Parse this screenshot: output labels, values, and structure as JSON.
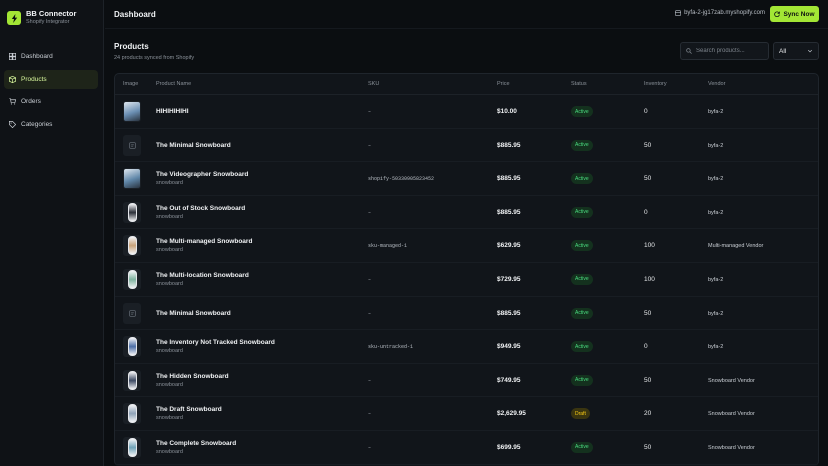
{
  "app": {
    "name": "BB Connector",
    "subtitle": "Shopify Integrator",
    "accent": "#a3e635"
  },
  "nav": [
    {
      "label": "Dashboard",
      "icon": "dashboard-icon",
      "active": false
    },
    {
      "label": "Products",
      "icon": "package-icon",
      "active": true
    },
    {
      "label": "Orders",
      "icon": "cart-icon",
      "active": false
    },
    {
      "label": "Categories",
      "icon": "tag-icon",
      "active": false
    }
  ],
  "header": {
    "title": "Dashboard",
    "store": "byfa-2-jg17zab.myshopify.com",
    "sync_label": "Sync Now"
  },
  "products": {
    "title": "Products",
    "subtitle": "24 products synced from Shopify",
    "search_placeholder": "Search products...",
    "filter_value": "All",
    "columns": [
      "Image",
      "Product Name",
      "SKU",
      "Price",
      "Status",
      "Inventory",
      "Vendor"
    ],
    "rows": [
      {
        "name": "HIHIHIHIHI",
        "type": "",
        "sku": "–",
        "price": "$10.00",
        "status": "Active",
        "inventory": "0",
        "vendor": "byfa-2",
        "thumb": "photo",
        "color": "#6b8fb3"
      },
      {
        "name": "The Minimal Snowboard",
        "type": "",
        "sku": "–",
        "price": "$885.95",
        "status": "Active",
        "inventory": "50",
        "vendor": "byfa-2",
        "thumb": "placeholder",
        "color": "#3a4149"
      },
      {
        "name": "The Videographer Snowboard",
        "type": "snowboard",
        "sku": "shopify-50330905823452",
        "price": "$885.95",
        "status": "Active",
        "inventory": "50",
        "vendor": "byfa-2",
        "thumb": "photo",
        "color": "#5f86a8"
      },
      {
        "name": "The Out of Stock Snowboard",
        "type": "snowboard",
        "sku": "–",
        "price": "$885.95",
        "status": "Active",
        "inventory": "0",
        "vendor": "byfa-2",
        "thumb": "board",
        "color": "#2b2f38"
      },
      {
        "name": "The Multi-managed Snowboard",
        "type": "snowboard",
        "sku": "sku-managed-1",
        "price": "$629.95",
        "status": "Active",
        "inventory": "100",
        "vendor": "Multi-managed Vendor",
        "thumb": "board",
        "color": "#c9a37a"
      },
      {
        "name": "The Multi-location Snowboard",
        "type": "snowboard",
        "sku": "–",
        "price": "$729.95",
        "status": "Active",
        "inventory": "100",
        "vendor": "byfa-2",
        "thumb": "board",
        "color": "#7fb3a0"
      },
      {
        "name": "The Minimal Snowboard",
        "type": "",
        "sku": "–",
        "price": "$885.95",
        "status": "Active",
        "inventory": "50",
        "vendor": "byfa-2",
        "thumb": "placeholder",
        "color": "#3a4149"
      },
      {
        "name": "The Inventory Not Tracked Snowboard",
        "type": "snowboard",
        "sku": "sku-untracked-1",
        "price": "$949.95",
        "status": "Active",
        "inventory": "0",
        "vendor": "byfa-2",
        "thumb": "board",
        "color": "#4d6fa8"
      },
      {
        "name": "The Hidden Snowboard",
        "type": "snowboard",
        "sku": "–",
        "price": "$749.95",
        "status": "Active",
        "inventory": "50",
        "vendor": "Snowboard Vendor",
        "thumb": "board",
        "color": "#3d4a63"
      },
      {
        "name": "The Draft Snowboard",
        "type": "snowboard",
        "sku": "–",
        "price": "$2,629.95",
        "status": "Draft",
        "inventory": "20",
        "vendor": "Snowboard Vendor",
        "thumb": "board",
        "color": "#8fa3b8"
      },
      {
        "name": "The Complete Snowboard",
        "type": "snowboard",
        "sku": "–",
        "price": "$699.95",
        "status": "Active",
        "inventory": "50",
        "vendor": "Snowboard Vendor",
        "thumb": "board",
        "color": "#6fa3b8"
      }
    ]
  }
}
